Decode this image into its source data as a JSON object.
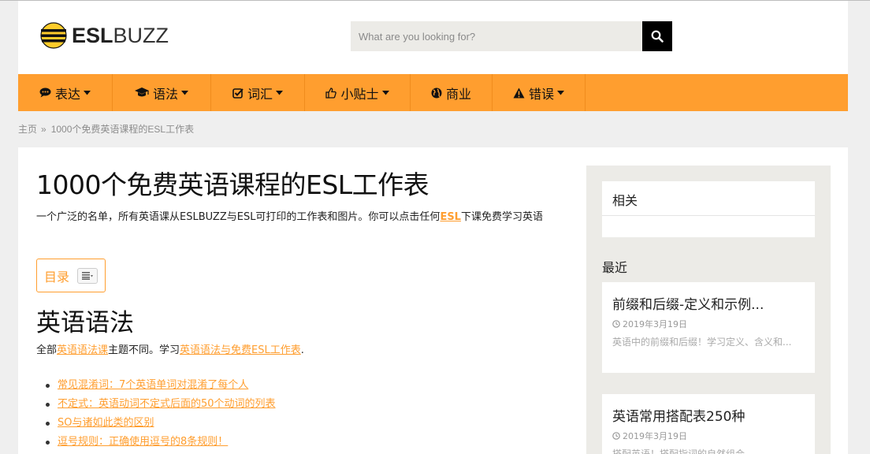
{
  "brand": {
    "esl": "ESL",
    "buzz": "BUZZ"
  },
  "search": {
    "placeholder": "What are you looking for?"
  },
  "nav": {
    "items": [
      {
        "label": "表达",
        "icon": "comment-icon"
      },
      {
        "label": "语法",
        "icon": "graduation-cap-icon"
      },
      {
        "label": "词汇",
        "icon": "check-square-icon"
      },
      {
        "label": "小贴士",
        "icon": "thumbs-up-icon"
      },
      {
        "label": "商业",
        "icon": "globe-icon"
      },
      {
        "label": "错误",
        "icon": "warning-icon"
      }
    ]
  },
  "breadcrumb": {
    "home": "主页",
    "separator": "»",
    "current": "1000个免费英语课程的ESL工作表"
  },
  "article": {
    "title": "1000个免费英语课程的ESL工作表",
    "intro_before": "一个广泛的名单，所有英语课从ESLBUZZ与ESL可打印的工作表和图片。你可以点击任何",
    "intro_link": "ESL",
    "intro_after": "下课免费学习英语",
    "toc_label": "目录",
    "section_title": "英语语法",
    "section_desc_1": "全部",
    "section_link_1": "英语语法课",
    "section_desc_2": "主题不同。学习",
    "section_link_2": "英语语法与免费ESL工作表",
    "section_desc_3": ".",
    "list": [
      "常见混淆词：7个英语单词对混淆了每个人",
      "不定式：英语动词不定式后面的50个动词的列表",
      "SO与诸如此类的区别",
      "逗号规则：正确使用逗号的8条规则！"
    ]
  },
  "sidebar": {
    "related_title": "相关",
    "recent_title": "最近",
    "posts": [
      {
        "title": "前缀和后缀-定义和示例...",
        "date": "2019年3月19日",
        "excerpt": "英语中的前缀和后缀！学习定义、含义和..."
      },
      {
        "title": "英语常用搭配表250种",
        "date": "2019年3月19日",
        "excerpt": "搭配英语！搭配指词的自然组合"
      }
    ]
  },
  "colors": {
    "accent": "#ff9e2f",
    "nav_bg": "#ff9e2f",
    "sidebar_bg": "#ecebe7"
  }
}
